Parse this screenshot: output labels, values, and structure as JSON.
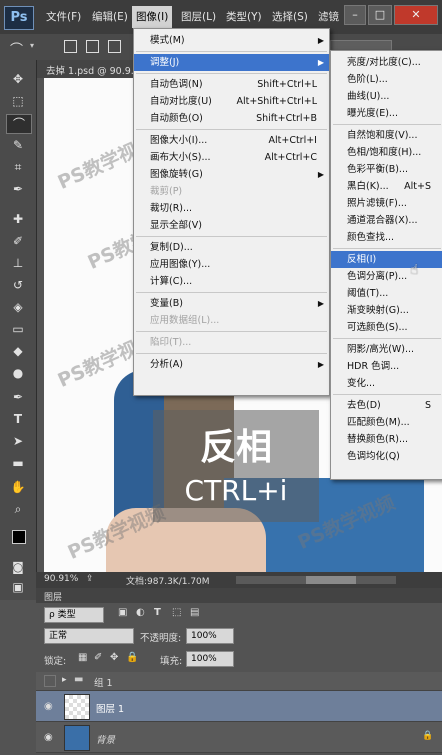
{
  "app": {
    "logo": "Ps",
    "file_tab": "去掉 1.psd @ 90.9..."
  },
  "menubar": [
    "文件(F)",
    "编辑(E)",
    "图像(I)",
    "图层(L)",
    "类型(Y)",
    "选择(S)",
    "滤镜"
  ],
  "window_buttons": [
    "–",
    "□",
    "✕"
  ],
  "image_menu": [
    {
      "label": "模式(M)",
      "shortcut": "",
      "submenu": true,
      "enabled": true
    },
    {
      "separator": true
    },
    {
      "label": "调整(J)",
      "shortcut": "",
      "submenu": true,
      "enabled": true,
      "highlight": true
    },
    {
      "separator": true
    },
    {
      "label": "自动色调(N)",
      "shortcut": "Shift+Ctrl+L",
      "enabled": true
    },
    {
      "label": "自动对比度(U)",
      "shortcut": "Alt+Shift+Ctrl+L",
      "enabled": true
    },
    {
      "label": "自动颜色(O)",
      "shortcut": "Shift+Ctrl+B",
      "enabled": true
    },
    {
      "separator": true
    },
    {
      "label": "图像大小(I)...",
      "shortcut": "Alt+Ctrl+I",
      "enabled": true
    },
    {
      "label": "画布大小(S)...",
      "shortcut": "Alt+Ctrl+C",
      "enabled": true
    },
    {
      "label": "图像旋转(G)",
      "shortcut": "",
      "submenu": true,
      "enabled": true
    },
    {
      "label": "裁剪(P)",
      "shortcut": "",
      "enabled": false
    },
    {
      "label": "裁切(R)...",
      "shortcut": "",
      "enabled": true
    },
    {
      "label": "显示全部(V)",
      "shortcut": "",
      "enabled": true
    },
    {
      "separator": true
    },
    {
      "label": "复制(D)...",
      "shortcut": "",
      "enabled": true
    },
    {
      "label": "应用图像(Y)...",
      "shortcut": "",
      "enabled": true
    },
    {
      "label": "计算(C)...",
      "shortcut": "",
      "enabled": true
    },
    {
      "separator": true
    },
    {
      "label": "变量(B)",
      "shortcut": "",
      "submenu": true,
      "enabled": true
    },
    {
      "label": "应用数据组(L)...",
      "shortcut": "",
      "enabled": false
    },
    {
      "separator": true
    },
    {
      "label": "陷印(T)...",
      "shortcut": "",
      "enabled": false
    },
    {
      "separator": true
    },
    {
      "label": "分析(A)",
      "shortcut": "",
      "submenu": true,
      "enabled": true
    }
  ],
  "adjust_menu": [
    {
      "label": "亮度/对比度(C)..."
    },
    {
      "label": "色阶(L)..."
    },
    {
      "label": "曲线(U)..."
    },
    {
      "label": "曝光度(E)..."
    },
    {
      "separator": true
    },
    {
      "label": "自然饱和度(V)..."
    },
    {
      "label": "色相/饱和度(H)..."
    },
    {
      "label": "色彩平衡(B)..."
    },
    {
      "label": "黑白(K)...",
      "shortcut": "Alt+S"
    },
    {
      "label": "照片滤镜(F)..."
    },
    {
      "label": "通道混合器(X)..."
    },
    {
      "label": "颜色查找..."
    },
    {
      "separator": true
    },
    {
      "label": "反相(I)",
      "highlight": true
    },
    {
      "label": "色调分离(P)..."
    },
    {
      "label": "阈值(T)..."
    },
    {
      "label": "渐变映射(G)..."
    },
    {
      "label": "可选颜色(S)..."
    },
    {
      "separator": true
    },
    {
      "label": "阴影/高光(W)..."
    },
    {
      "label": "HDR 色调..."
    },
    {
      "label": "变化..."
    },
    {
      "separator": true
    },
    {
      "label": "去色(D)",
      "shortcut": "S"
    },
    {
      "label": "匹配颜色(M)..."
    },
    {
      "label": "替换颜色(R)..."
    },
    {
      "label": "色调均化(Q)"
    }
  ],
  "watermark": "PS教学视频",
  "overlay": {
    "title": "反相",
    "shortcut": "CTRL+i"
  },
  "status": {
    "zoom": "90.91%",
    "doc": "文档:987.3K/1.70M"
  },
  "layers_panel": {
    "tab": "图层",
    "filter_kind": "ρ 类型",
    "blend_mode": "正常",
    "opacity_label": "不透明度:",
    "opacity_value": "100%",
    "lock_label": "锁定:",
    "fill_label": "填充:",
    "fill_value": "100%",
    "layers": [
      {
        "name": "组 1",
        "type": "group",
        "visible": false
      },
      {
        "name": "图层 1",
        "type": "layer",
        "visible": true,
        "selected": true
      },
      {
        "name": "背景",
        "type": "background",
        "visible": true,
        "locked": true
      }
    ]
  },
  "colors": {
    "menu_highlight": "#3d74cc",
    "panel_bg": "#535353",
    "selected_layer": "#6e7f9a"
  }
}
